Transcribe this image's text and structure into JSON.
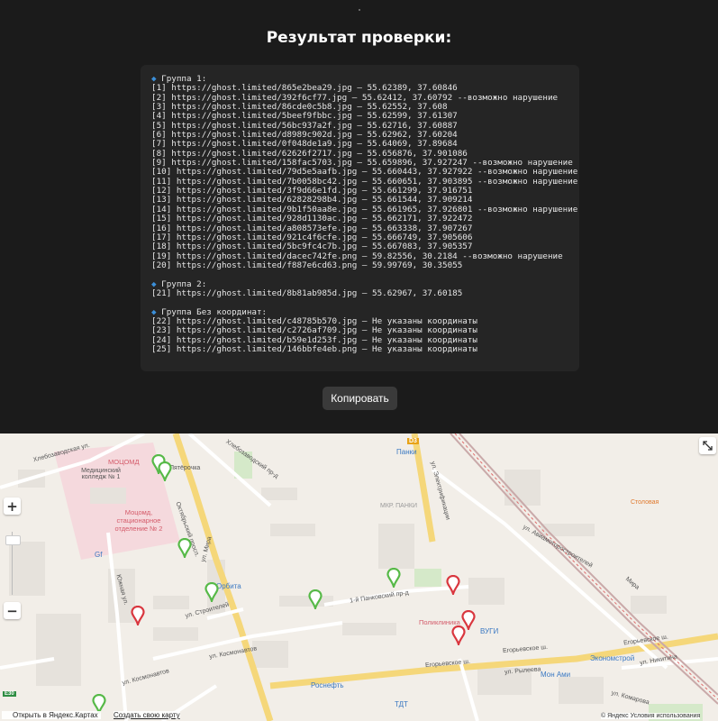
{
  "title": "Результат проверки:",
  "result": {
    "groups": [
      {
        "header": "Группа 1:",
        "lines": [
          "[1] https://ghost.limited/865e2bea29.jpg — 55.62389, 37.60846",
          "[2] https://ghost.limited/392f6cf77.jpg — 55.62412, 37.60792 --возможно нарушение",
          "[3] https://ghost.limited/86cde0c5b8.jpg — 55.62552, 37.608",
          "[4] https://ghost.limited/5beef9fbbc.jpg — 55.62599, 37.61307",
          "[5] https://ghost.limited/56bc937a2f.jpg — 55.62716, 37.60887",
          "[6] https://ghost.limited/d8989c902d.jpg — 55.62962, 37.60204",
          "[7] https://ghost.limited/0f048de1a9.jpg — 55.64069, 37.89684",
          "[8] https://ghost.limited/62626f2717.jpg — 55.656876, 37.901086",
          "[9] https://ghost.limited/158fac5703.jpg — 55.659896, 37.927247 --возможно нарушение",
          "[10] https://ghost.limited/79d5e5aafb.jpg — 55.660443, 37.927922 --возможно нарушение",
          "[11] https://ghost.limited/7b0058bc42.jpg — 55.660651, 37.903895 --возможно нарушение",
          "[12] https://ghost.limited/3f9d66e1fd.jpg — 55.661299, 37.916751",
          "[13] https://ghost.limited/62828298b4.jpg — 55.661544, 37.909214",
          "[14] https://ghost.limited/9b1f50aa8e.jpg — 55.661965, 37.926801 --возможно нарушение",
          "[15] https://ghost.limited/928d1130ac.jpg — 55.662171, 37.922472",
          "[16] https://ghost.limited/a808573efe.jpg — 55.663338, 37.907267",
          "[17] https://ghost.limited/921c4f6cfe.jpg — 55.666749, 37.905606",
          "[18] https://ghost.limited/5bc9fc4c7b.jpg — 55.667083, 37.905357",
          "[19] https://ghost.limited/dacec742fe.png — 59.82556, 30.2184 --возможно нарушение",
          "[20] https://ghost.limited/f887e6cd63.png — 59.99769, 30.35055"
        ]
      },
      {
        "header": "Группа 2:",
        "lines": [
          "[21] https://ghost.limited/8b81ab985d.jpg — 55.62967, 37.60185"
        ]
      },
      {
        "header": "Группа Без координат:",
        "lines": [
          "[22] https://ghost.limited/c48785b570.jpg — Не указаны координаты",
          "[23] https://ghost.limited/c2726af709.jpg — Не указаны координаты",
          "[24] https://ghost.limited/b59e1d253f.jpg — Не указаны координаты",
          "[25] https://ghost.limited/146bbfe4eb.png — Не указаны координаты"
        ]
      }
    ],
    "bullet": "◆"
  },
  "copy_button": "Копировать",
  "map": {
    "labels": {
      "street_khlebozavodskaya": "Хлебозаводская ул.",
      "moscomd": "МОЦОМД",
      "med_college": "Медицинский колледж № 1",
      "moscomd_hosp": "Моцомд, стационарное отделение № 2",
      "pyaterochka": "Пятёрочка",
      "gf": "Gf",
      "oktyabrsky": "Октябрьский просп.",
      "khlebozavodsky_pr": "Хлебозаводский пр-д",
      "orbita": "Орбита",
      "mira": "ул. Мира",
      "yuzhnaya": "Южная ул.",
      "stroiteley": "ул. Строителей",
      "kosmonavtov1": "ул. Космонавтов",
      "kosmonavtov2": "ул. Космонавтов",
      "rosneft": "Роснефть",
      "panki_metro": "D3",
      "panki": "Панки",
      "mkr_panki": "МКР. ПАНКИ",
      "elektrifikatsii": "ул. Электрификации",
      "aviamotor": "ул. Авиамоторостроителей",
      "mira2": "Мира",
      "stolovaya": "Столовая",
      "pankovsky": "1-й Панковский пр-д",
      "poliklinika": "Поликлиника",
      "vugi": "ВУГИ",
      "egorievskoe1": "Егорьевское ш.",
      "egorievskoe2": "Егорьевское ш.",
      "egorievskoe3": "Егорьевское ш.",
      "ekonomstroy": "Экономстрой",
      "nikitina": "ул. Никитина",
      "monami": "Мон Ами",
      "ryleeva": "ул. Рылеева",
      "tdt": "ТДТ",
      "komarova": "ул. Комарова",
      "e30": "E30",
      "m5": "М5"
    },
    "open_link": "Открыть в Яндекс.Картах",
    "create_link": "Создать свою карту",
    "legal": "© Яндекс Условия использования",
    "zoom_in": "+",
    "zoom_out": "−",
    "colors": {
      "violation": "#d9363e",
      "ok": "#56b947",
      "metro": "#e8a317"
    }
  }
}
